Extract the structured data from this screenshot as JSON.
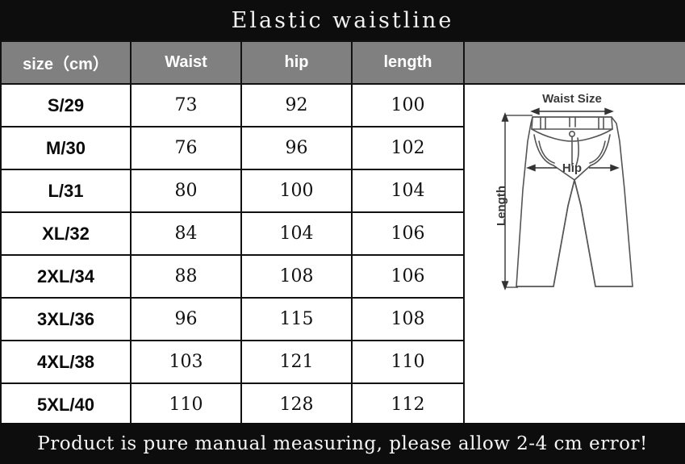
{
  "title": "Elastic waistline",
  "footer_note": "Product is pure manual measuring,  please allow 2-4 cm error!",
  "colors": {
    "band_background": "#0d0d0d",
    "band_text": "#f2f2f2",
    "header_row_background": "#808080",
    "header_row_text": "#ffffff",
    "table_background": "#ffffff",
    "table_border": "#111111",
    "cell_text": "#111111",
    "diagram_stroke": "#555555"
  },
  "table": {
    "headers": [
      "size（cm）",
      "Waist",
      "hip",
      "length",
      ""
    ],
    "rows": [
      {
        "size": "S/29",
        "waist": "73",
        "hip": "92",
        "length": "100"
      },
      {
        "size": "M/30",
        "waist": "76",
        "hip": "96",
        "length": "102"
      },
      {
        "size": "L/31",
        "waist": "80",
        "hip": "100",
        "length": "104"
      },
      {
        "size": "XL/32",
        "waist": "84",
        "hip": "104",
        "length": "106"
      },
      {
        "size": "2XL/34",
        "waist": "88",
        "hip": "108",
        "length": "106"
      },
      {
        "size": "3XL/36",
        "waist": "96",
        "hip": "115",
        "length": "108"
      },
      {
        "size": "4XL/38",
        "waist": "103",
        "hip": "121",
        "length": "110"
      },
      {
        "size": "5XL/40",
        "waist": "110",
        "hip": "128",
        "length": "112"
      }
    ]
  },
  "diagram": {
    "name": "jeans-measurement-diagram",
    "labels": {
      "waist": "Waist Size",
      "hip": "Hip",
      "length": "Length"
    }
  }
}
